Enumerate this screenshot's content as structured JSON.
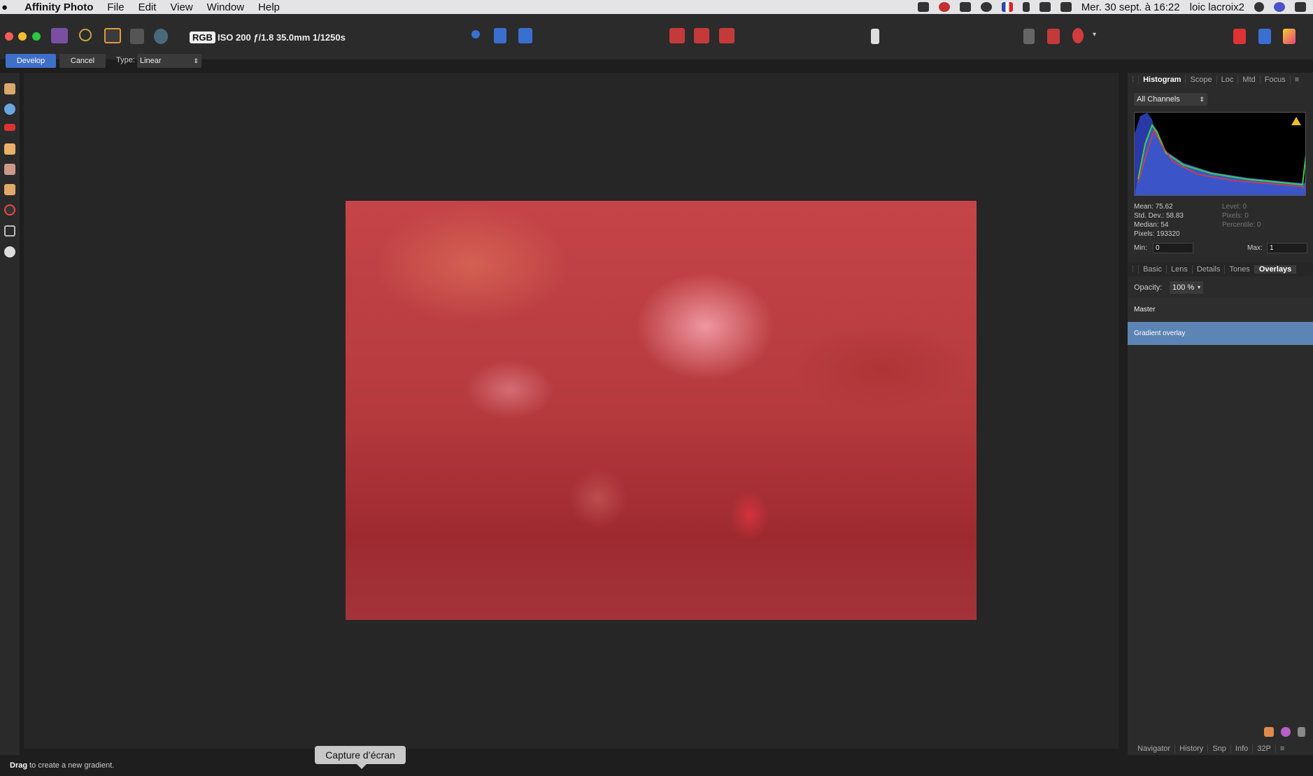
{
  "menubar": {
    "app_name": "Affinity Photo",
    "items": [
      "File",
      "Edit",
      "View",
      "Window",
      "Help"
    ],
    "datetime": "Mer. 30 sept. à 16:22",
    "user": "loic lacroix2"
  },
  "toolbar": {
    "color_mode": "RGB",
    "exif": "ISO 200 ƒ/1.8 35.0mm 1/1250s"
  },
  "context_bar": {
    "develop_label": "Develop",
    "cancel_label": "Cancel",
    "type_label": "Type:",
    "type_value": "Linear"
  },
  "right_panel": {
    "top_tabs": [
      "Histogram",
      "Scope",
      "Loc",
      "Mtd",
      "Focus"
    ],
    "active_top_tab": "Histogram",
    "channel_select": "All Channels",
    "stats": {
      "mean": "Mean: 75.62",
      "std_dev": "Std. Dev.: 58.83",
      "median": "Median: 54",
      "pixels": "Pixels: 193320",
      "level": "Level: 0",
      "pixels_right": "Pixels: 0",
      "percentile": "Percentile: 0"
    },
    "min_label": "Min:",
    "min_value": "0",
    "max_label": "Max:",
    "max_value": "1",
    "adj_tabs": [
      "Basic",
      "Lens",
      "Details",
      "Tones",
      "Overlays"
    ],
    "active_adj_tab": "Overlays",
    "opacity_label": "Opacity:",
    "opacity_value": "100 %",
    "overlays": [
      "Master",
      "Gradient overlay"
    ],
    "selected_overlay": "Gradient overlay",
    "bottom_tabs": [
      "Navigator",
      "History",
      "Snp",
      "Info",
      "32P"
    ]
  },
  "status": {
    "drag": "Drag",
    "hint": " to create a new gradient."
  },
  "tooltip": "Capture d’écran",
  "colors": {
    "accent": "#3e6fc9",
    "selection": "#5c84b5",
    "photo_tint": "#c54448"
  }
}
